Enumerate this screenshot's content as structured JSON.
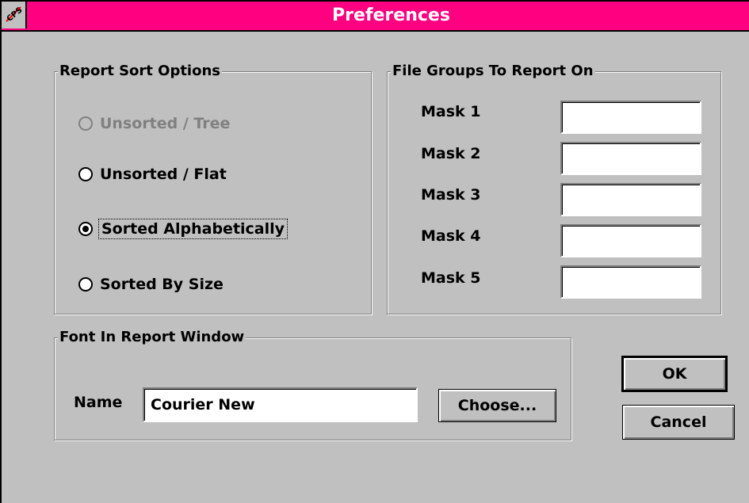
{
  "window": {
    "title": "Preferences",
    "icon": "cps-app-icon",
    "title_bar_color": "#ff0080"
  },
  "sort_group": {
    "title": "Report Sort Options",
    "options": [
      {
        "label": "Unsorted / Tree",
        "selected": false,
        "enabled": false
      },
      {
        "label": "Unsorted / Flat",
        "selected": false,
        "enabled": true
      },
      {
        "label": "Sorted Alphabetically",
        "selected": true,
        "enabled": true
      },
      {
        "label": "Sorted By Size",
        "selected": false,
        "enabled": true
      }
    ]
  },
  "masks_group": {
    "title": "File Groups To Report On",
    "masks": [
      {
        "label": "Mask 1",
        "value": ""
      },
      {
        "label": "Mask 2",
        "value": ""
      },
      {
        "label": "Mask 3",
        "value": ""
      },
      {
        "label": "Mask 4",
        "value": ""
      },
      {
        "label": "Mask 5",
        "value": ""
      }
    ]
  },
  "font_group": {
    "title": "Font In Report Window",
    "name_label": "Name",
    "name_value": "Courier New",
    "choose_label": "Choose..."
  },
  "buttons": {
    "ok_label": "OK",
    "cancel_label": "Cancel"
  }
}
